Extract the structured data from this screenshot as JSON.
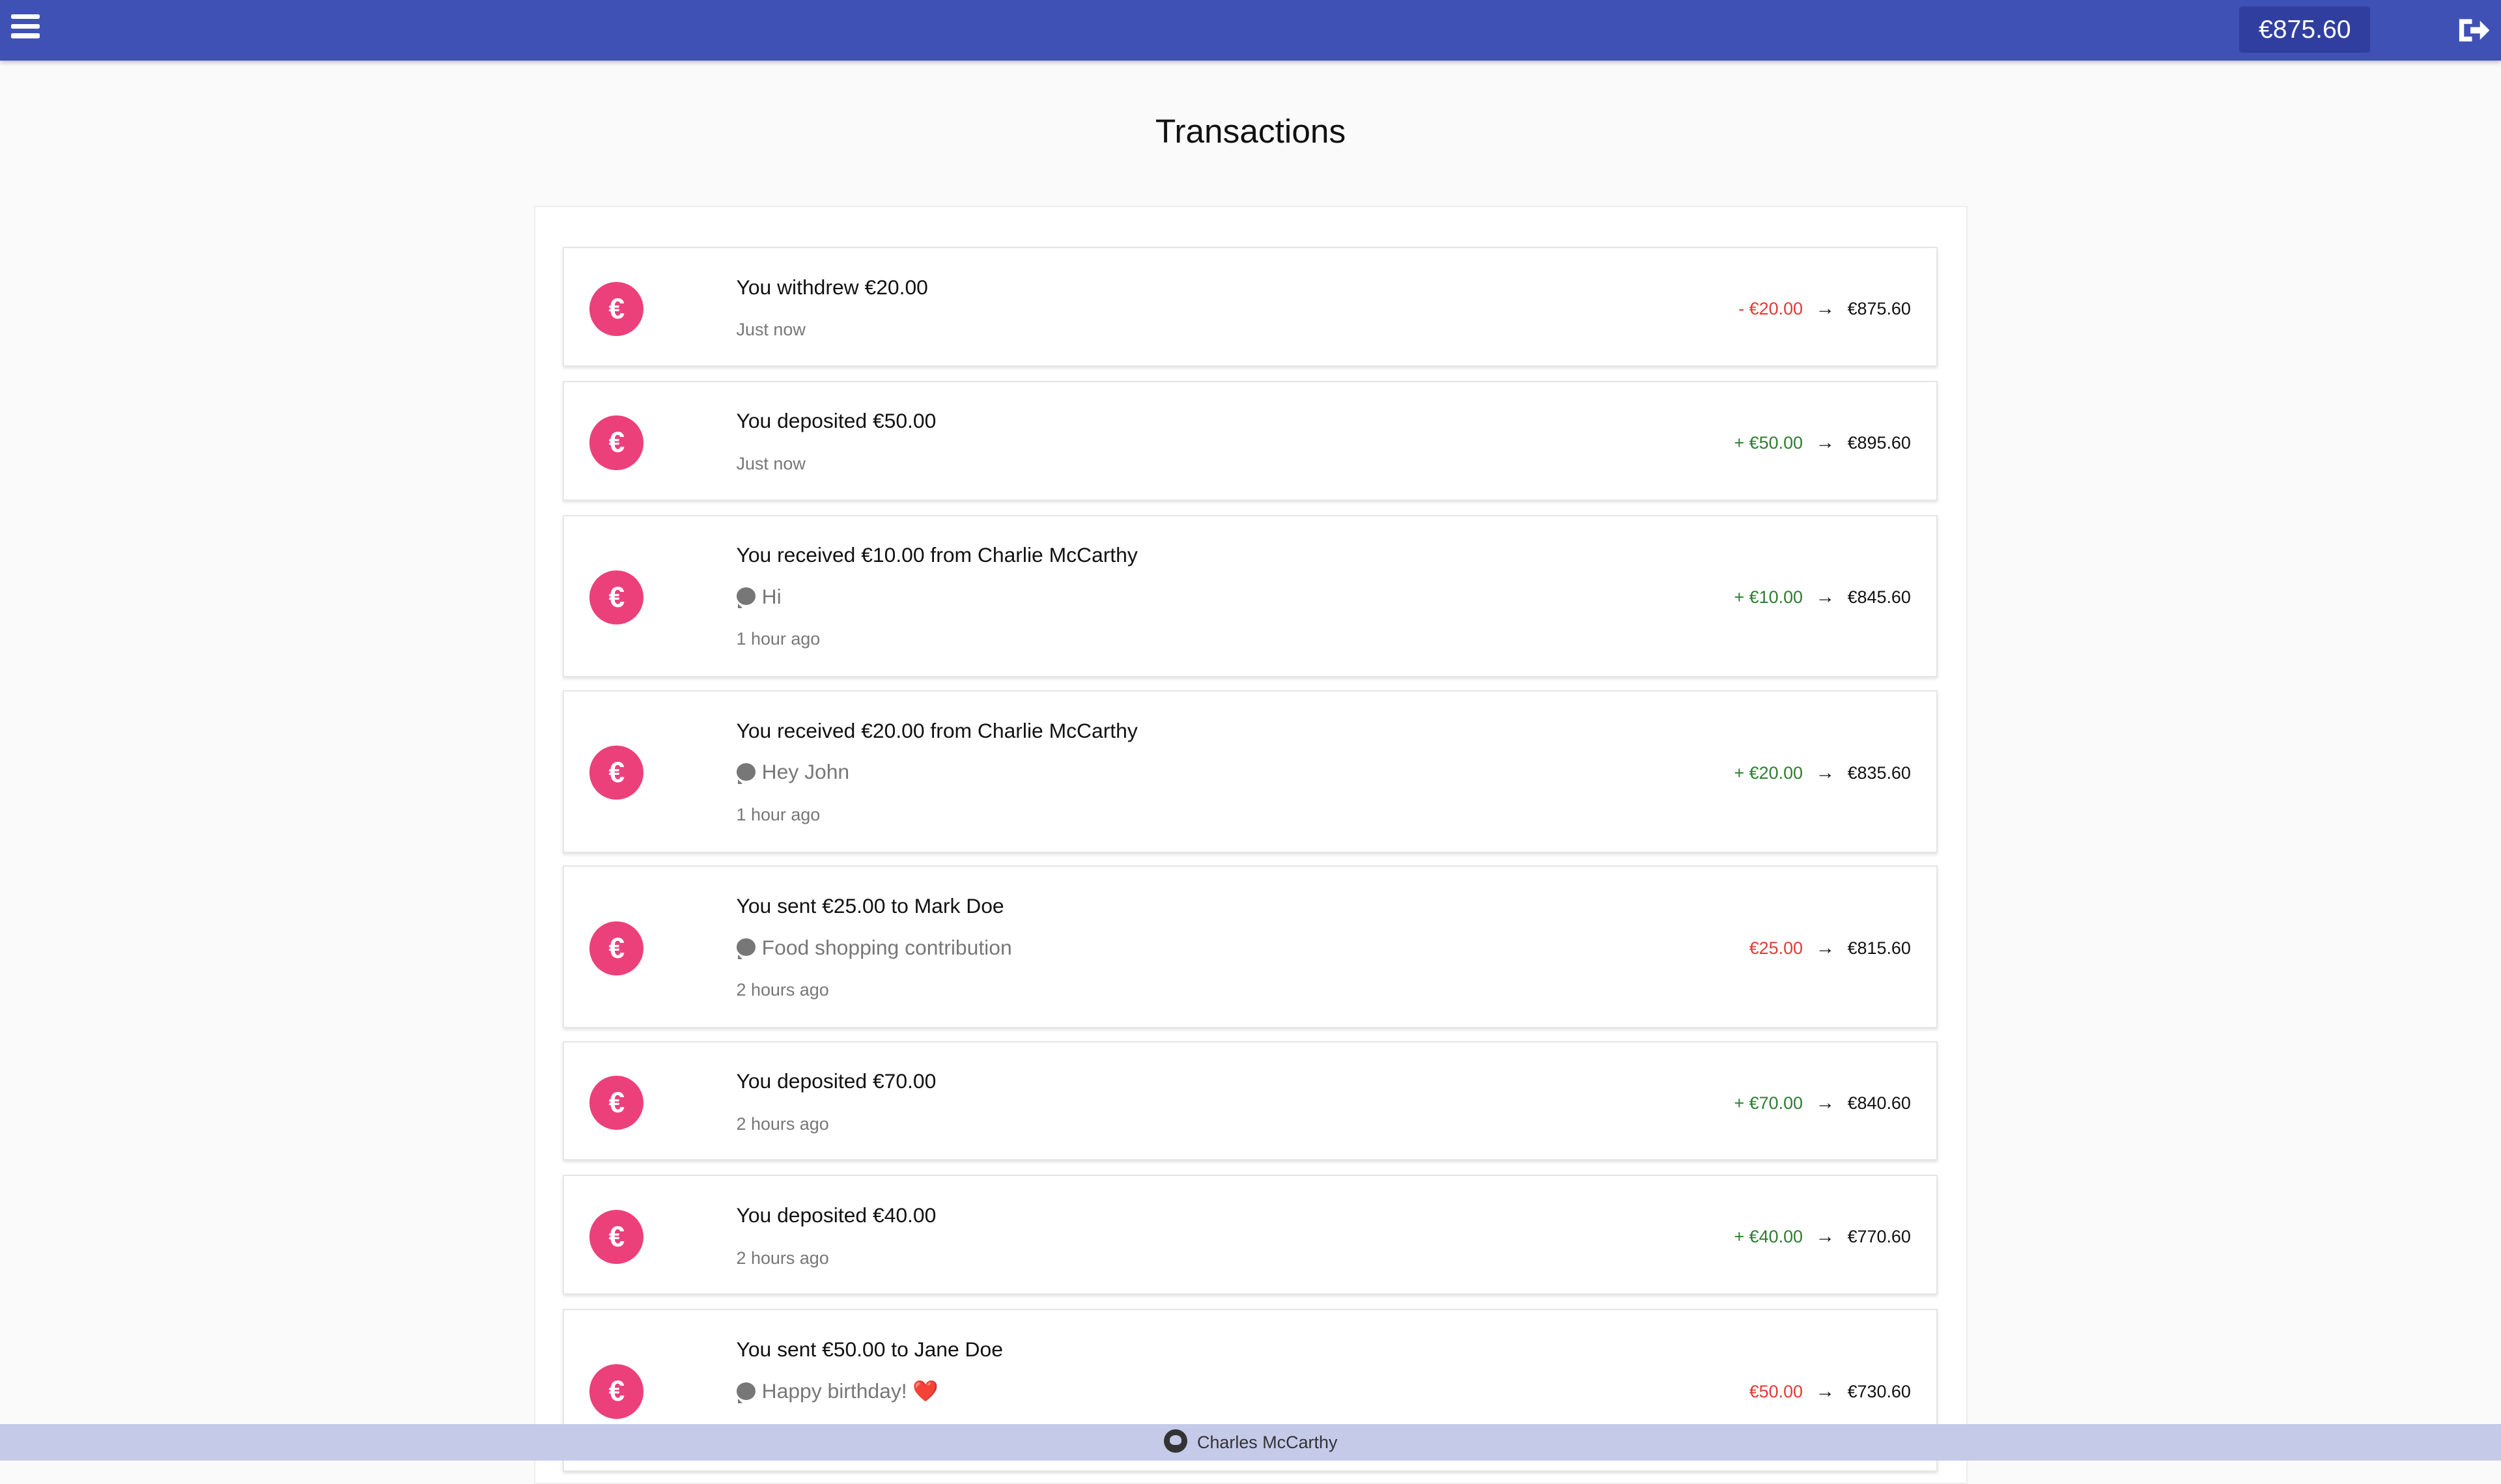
{
  "header": {
    "balance": "€875.60"
  },
  "page": {
    "title": "Transactions"
  },
  "currency_icon": "€",
  "transactions": [
    {
      "title": "You withdrew €20.00",
      "message": "",
      "time": "Just now",
      "delta": "- €20.00",
      "delta_color": "#e53935",
      "balance_after": "€875.60"
    },
    {
      "title": "You deposited €50.00",
      "message": "",
      "time": "Just now",
      "delta": "+ €50.00",
      "delta_color": "#2e7d32",
      "balance_after": "€895.60"
    },
    {
      "title": "You received €10.00 from Charlie McCarthy",
      "message": "Hi",
      "time": "1 hour ago",
      "delta": "+ €10.00",
      "delta_color": "#2e7d32",
      "balance_after": "€845.60"
    },
    {
      "title": "You received €20.00 from Charlie McCarthy",
      "message": "Hey John",
      "time": "1 hour ago",
      "delta": "+ €20.00",
      "delta_color": "#2e7d32",
      "balance_after": "€835.60"
    },
    {
      "title": "You sent €25.00 to Mark Doe",
      "message": "Food shopping contribution",
      "time": "2 hours ago",
      "delta": "€25.00",
      "delta_color": "#e53935",
      "balance_after": "€815.60"
    },
    {
      "title": "You deposited €70.00",
      "message": "",
      "time": "2 hours ago",
      "delta": "+ €70.00",
      "delta_color": "#2e7d32",
      "balance_after": "€840.60"
    },
    {
      "title": "You deposited €40.00",
      "message": "",
      "time": "2 hours ago",
      "delta": "+ €40.00",
      "delta_color": "#2e7d32",
      "balance_after": "€770.60"
    },
    {
      "title": "You sent €50.00 to Jane Doe",
      "message": "Happy birthday! ❤️",
      "time": "",
      "delta": "€50.00",
      "delta_color": "#e53935",
      "balance_after": "€730.60"
    }
  ],
  "footer": {
    "author": "Charles McCarthy",
    "icon": "github-icon"
  },
  "colors": {
    "topbar": "#3f51b5",
    "avatar": "#ec407a",
    "footer": "#c5cae9"
  }
}
